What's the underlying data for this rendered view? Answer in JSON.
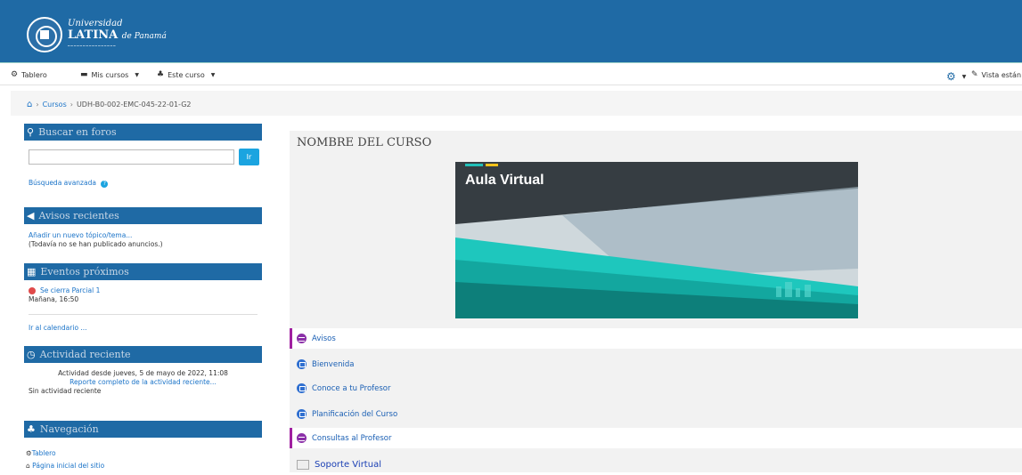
{
  "header": {
    "logo_line1": "Universidad",
    "logo_line2": "LATINA",
    "logo_line2_suffix": "de Panamá"
  },
  "navbar": {
    "tablero": "Tablero",
    "mis_cursos": "Mis cursos",
    "este_curso": "Este curso",
    "vista": "Vista están"
  },
  "breadcrumb": {
    "cursos": "Cursos",
    "course_code": "UDH-B0-002-EMC-045-22-01-G2"
  },
  "blocks": {
    "search": {
      "title": "Buscar en foros",
      "button": "Ir",
      "advanced": "Búsqueda avanzada"
    },
    "avisos": {
      "title": "Avisos recientes",
      "add": "Añadir un nuevo tópico/tema...",
      "none": "(Todavía no se han publicado anuncios.)"
    },
    "eventos": {
      "title": "Eventos próximos",
      "event_name": "Se cierra Parcial 1",
      "event_time": "Mañana, 16:50",
      "calendar_link": "Ir al calendario ..."
    },
    "actividad": {
      "title": "Actividad reciente",
      "since": "Actividad desde jueves, 5 de mayo de 2022, 11:08",
      "report": "Reporte completo de la actividad reciente...",
      "none": "Sin actividad reciente"
    },
    "navegacion": {
      "title": "Navegación",
      "tablero": "Tablero",
      "pagina_inicial": "Página inicial del sitio"
    }
  },
  "main": {
    "course_title": "NOMBRE DEL CURSO",
    "banner_title": "Aula Virtual",
    "activities": [
      {
        "label": "Avisos",
        "icon": "forum-icon"
      },
      {
        "label": "Bienvenida",
        "icon": "page-icon"
      },
      {
        "label": "Conoce a tu Profesor",
        "icon": "page-icon"
      },
      {
        "label": "Planificación del Curso",
        "icon": "page-icon"
      },
      {
        "label": "Consultas al Profesor",
        "icon": "forum-icon"
      },
      {
        "label": "Soporte Virtual",
        "icon": "broken-image-icon"
      }
    ]
  },
  "colors": {
    "header": "#1f6aa5",
    "block_header": "#1f6aa5",
    "link": "#1a73c8",
    "forum_icon": "#8b2fa8",
    "page_icon": "#2f6fd0"
  }
}
